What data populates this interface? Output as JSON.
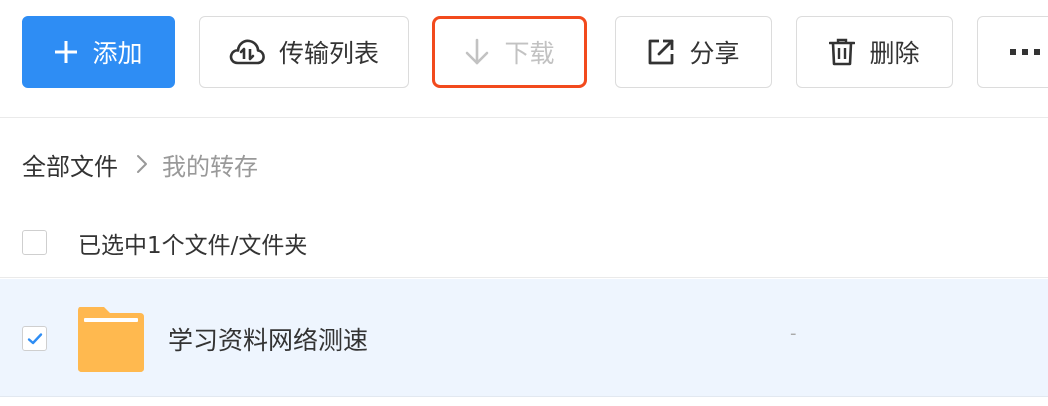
{
  "toolbar": {
    "add_label": "添加",
    "transfer_label": "传输列表",
    "download_label": "下载",
    "share_label": "分享",
    "delete_label": "删除",
    "accent_color": "#2e8df4",
    "highlight_color": "#f24a1d"
  },
  "breadcrumb": {
    "root": "全部文件",
    "current": "我的转存"
  },
  "selection": {
    "summary": "已选中1个文件/文件夹",
    "all_checked": false
  },
  "files": [
    {
      "name": "学习资料网络测速",
      "size": "-",
      "type": "folder",
      "checked": true
    }
  ]
}
